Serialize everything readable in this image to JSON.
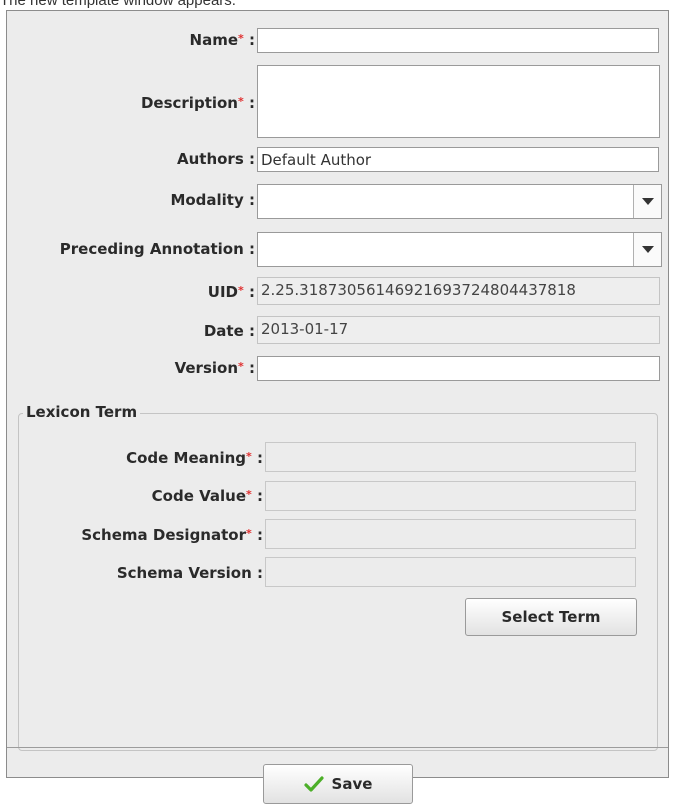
{
  "caption": "The new template window appears.",
  "form": {
    "name": {
      "label": "Name",
      "value": ""
    },
    "description": {
      "label": "Description",
      "value": ""
    },
    "authors": {
      "label": "Authors",
      "value": "Default Author"
    },
    "modality": {
      "label": "Modality",
      "value": ""
    },
    "preceding_annotation": {
      "label": "Preceding Annotation",
      "value": ""
    },
    "uid": {
      "label": "UID",
      "value": "2.25.31873056146921693724804437818"
    },
    "date": {
      "label": "Date",
      "value": "2013-01-17"
    },
    "version": {
      "label": "Version",
      "value": ""
    }
  },
  "lexicon": {
    "title": "Lexicon Term",
    "code_meaning": {
      "label": "Code Meaning",
      "value": ""
    },
    "code_value": {
      "label": "Code Value",
      "value": ""
    },
    "schema_designator": {
      "label": "Schema Designator",
      "value": ""
    },
    "schema_version": {
      "label": "Schema Version",
      "value": ""
    },
    "select_term_label": "Select Term"
  },
  "footer": {
    "save_label": "Save"
  },
  "ui": {
    "required_mark": "*",
    "colon": ":"
  },
  "colors": {
    "required": "#e03030",
    "check": "#4caf28"
  },
  "icons": {
    "save": "checkmark-icon",
    "dropdown": "chevron-down-icon"
  }
}
